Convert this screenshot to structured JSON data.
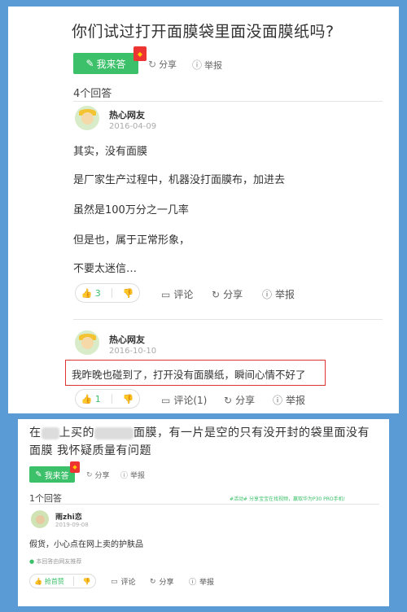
{
  "q1": {
    "title": "你们试过打开面膜袋里面没面膜纸吗?",
    "answer_button": "我来答",
    "share": "分享",
    "report": "举报",
    "answer_count": "4个回答",
    "answers": [
      {
        "user": "热心网友",
        "date": "2016-04-09",
        "lines": [
          "其实，没有面膜",
          "是厂家生产过程中，机器没打面膜布，加进去",
          "虽然是100万分之一几率",
          "但是也，属于正常形象，",
          "不要太迷信…"
        ],
        "likes": "3",
        "comment": "评论",
        "share": "分享",
        "report": "举报"
      },
      {
        "user": "热心网友",
        "date": "2016-10-10",
        "lines": [
          "我昨晚也碰到了，打开没有面膜纸，瞬间心情不好了"
        ],
        "likes": "1",
        "comment": "评论(1)",
        "share": "分享",
        "report": "举报"
      }
    ]
  },
  "q2": {
    "title_a": "在",
    "title_b": "上买的",
    "title_c": "面膜，有一片是空的只有没开封的袋里面没有",
    "title_d": "面膜 我怀疑质量有问题",
    "answer_button": "我来答",
    "share": "分享",
    "report": "举报",
    "answer_count": "1个回答",
    "promo": "#活动# 分享宝宝在找视频，赢取华为P30 PRO手机!",
    "answer": {
      "user": "雨zhi恋",
      "date": "2019-09-08",
      "text": "假货，小心点在网上卖的护肤品",
      "source": "本回答由网友推荐",
      "vote_label": "抢首赞",
      "comment": "评论",
      "share": "分享",
      "report": "举报"
    }
  },
  "colors": {
    "accent": "#3cc06a",
    "frame": "#5b9bd5",
    "highlight": "#d33333"
  }
}
